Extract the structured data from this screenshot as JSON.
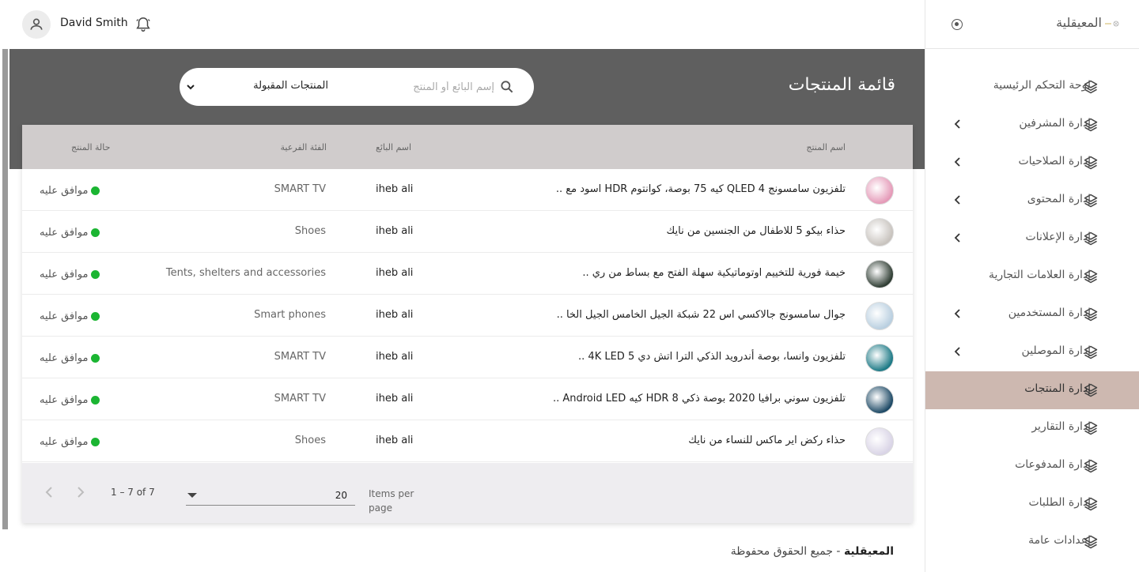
{
  "brand": "المعيقلية",
  "user": {
    "name": "David Smith"
  },
  "sidebar": {
    "items": [
      {
        "label": "لوحة التحكم الرئيسية",
        "has_chevron": false,
        "active": false
      },
      {
        "label": "إدارة المشرفين",
        "has_chevron": true,
        "active": false
      },
      {
        "label": "إدارة الصلاحيات",
        "has_chevron": true,
        "active": false
      },
      {
        "label": "إدارة المحتوى",
        "has_chevron": true,
        "active": false
      },
      {
        "label": "إدارة الإعلانات",
        "has_chevron": true,
        "active": false
      },
      {
        "label": "إدارة العلامات التجارية",
        "has_chevron": false,
        "active": false
      },
      {
        "label": "إدارة المستخدمين",
        "has_chevron": true,
        "active": false
      },
      {
        "label": "إدارة الموصلين",
        "has_chevron": true,
        "active": false
      },
      {
        "label": "إدارة المنتجات",
        "has_chevron": false,
        "active": true
      },
      {
        "label": "إدارة التقارير",
        "has_chevron": false,
        "active": false
      },
      {
        "label": "إدارة المدفوعات",
        "has_chevron": false,
        "active": false
      },
      {
        "label": "إدارة الطلبات",
        "has_chevron": false,
        "active": false
      },
      {
        "label": "إعدادات عامة",
        "has_chevron": false,
        "active": false
      }
    ]
  },
  "page": {
    "title": "قائمة المنتجات",
    "search_placeholder": "إسم البائع أو المنتج",
    "filter_selected": "المنتجات المقبولة"
  },
  "table": {
    "headers": {
      "product": "اسم المنتج",
      "vendor": "اسم البائع",
      "category": "الفئة الفرعية",
      "status": "حالة المنتج"
    },
    "rows": [
      {
        "product": "تلفزيون سامسونج QLED 4 كيه 75 بوصة، كوانتوم HDR اسود مع ..",
        "vendor": "iheb ali",
        "category": "SMART TV",
        "status": "موافق عليه",
        "thumb_color": "#e59ab8"
      },
      {
        "product": "حذاء بيكو 5 للاطفال من الجنسين من نايك",
        "vendor": "iheb ali",
        "category": "Shoes",
        "status": "موافق عليه",
        "thumb_color": "#c8c3be"
      },
      {
        "product": "خيمة فورية للتخييم اوتوماتيكية سهلة الفتح مع بساط من ري ..",
        "vendor": "iheb ali",
        "category": "Tents, shelters and accessories",
        "status": "موافق عليه",
        "thumb_color": "#2f3d33"
      },
      {
        "product": "جوال سامسونج جالاكسي اس 22 شبكة الجيل الخامس الجيل الخا ..",
        "vendor": "iheb ali",
        "category": "Smart phones",
        "status": "موافق عليه",
        "thumb_color": "#b9cfe0"
      },
      {
        "product": "تلفزيون وانسا، بوصة أندرويد الذكي الترا اتش دي 5 4K LED ..",
        "vendor": "iheb ali",
        "category": "SMART TV",
        "status": "موافق عليه",
        "thumb_color": "#1d7a86"
      },
      {
        "product": "تلفزيون سوني برافيا 2020 بوصة ذكي HDR 8 كيه Android LED ..",
        "vendor": "iheb ali",
        "category": "SMART TV",
        "status": "موافق عليه",
        "thumb_color": "#1e4a66"
      },
      {
        "product": "حذاء ركض اير ماكس للنساء من نايك",
        "vendor": "iheb ali",
        "category": "Shoes",
        "status": "موافق عليه",
        "thumb_color": "#d9d4e6"
      }
    ]
  },
  "pagination": {
    "items_per_page_label": "Items per page",
    "items_per_page_value": "20",
    "range_text": "1 – 7 of 7"
  },
  "footer": {
    "brand": "المعيقلية",
    "text": " - جميع الحقوق محفوظة"
  },
  "colors": {
    "banner": "#5f5f5f",
    "active_item": "#cdb8b0",
    "status_dot": "#1bb532"
  }
}
